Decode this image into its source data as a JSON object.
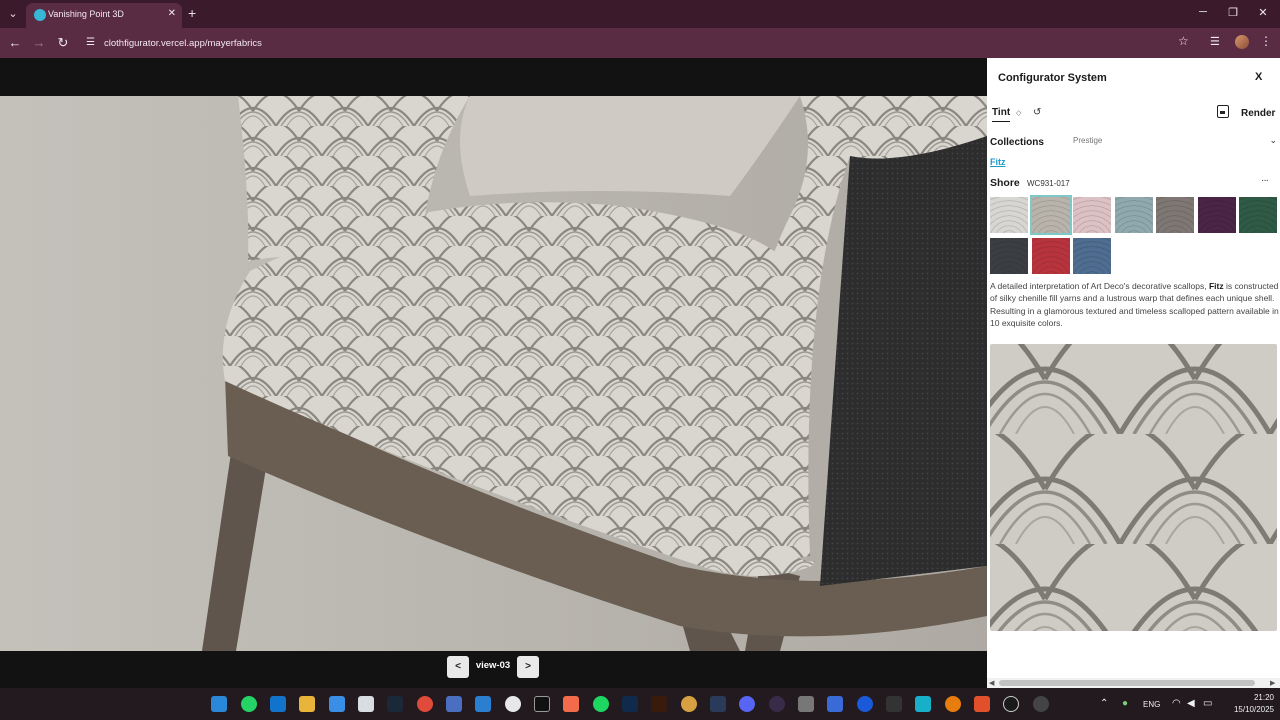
{
  "browser": {
    "tab_title": "Vanishing Point 3D",
    "url": "clothfigurator.vercel.app/mayerfabrics",
    "window_controls": [
      "─",
      "❐",
      "✕"
    ]
  },
  "viewport": {
    "view_label": "view-03",
    "prev_label": "<",
    "next_label": ">"
  },
  "panel": {
    "title": "Configurator System",
    "close_label": "X",
    "tint_label": "Tint",
    "render_label": "Render",
    "collections_label": "Collections",
    "collection_value": "Prestige",
    "fabric_name": "Fitz",
    "color_name": "Shore",
    "color_code": "WC931-017",
    "description_pre": "A detailed interpretation of Art Deco's decorative scallops, ",
    "description_bold": "Fitz",
    "description_post": " is constructed of silky chenille fill yarns and a lustrous warp that defines each unique shell. Resulting in a glamorous textured and timeless scalloped pattern available in 10 exquisite colors.",
    "swatches": [
      {
        "color": "#d8d6d2",
        "selected": false
      },
      {
        "color": "#b9b4ab",
        "selected": true
      },
      {
        "color": "#dcc2c4",
        "selected": false
      },
      {
        "color": "#8fa9ae",
        "selected": false
      },
      {
        "color": "#7e7774",
        "selected": false
      },
      {
        "color": "#4a2545",
        "selected": false
      },
      {
        "color": "#2f5a45",
        "selected": false
      },
      {
        "color": "#3b3f44",
        "selected": false
      },
      {
        "color": "#b8343d",
        "selected": false
      },
      {
        "color": "#4e6d90",
        "selected": false
      }
    ]
  },
  "taskbar": {
    "language": "ENG",
    "time": "21:20",
    "date": "15/10/2025"
  },
  "colors": {
    "chrome_dark": "#3b1a2b",
    "chrome_tab": "#5a2c44",
    "link": "#1f9ac8",
    "selected_outline": "#7ec8c8"
  }
}
